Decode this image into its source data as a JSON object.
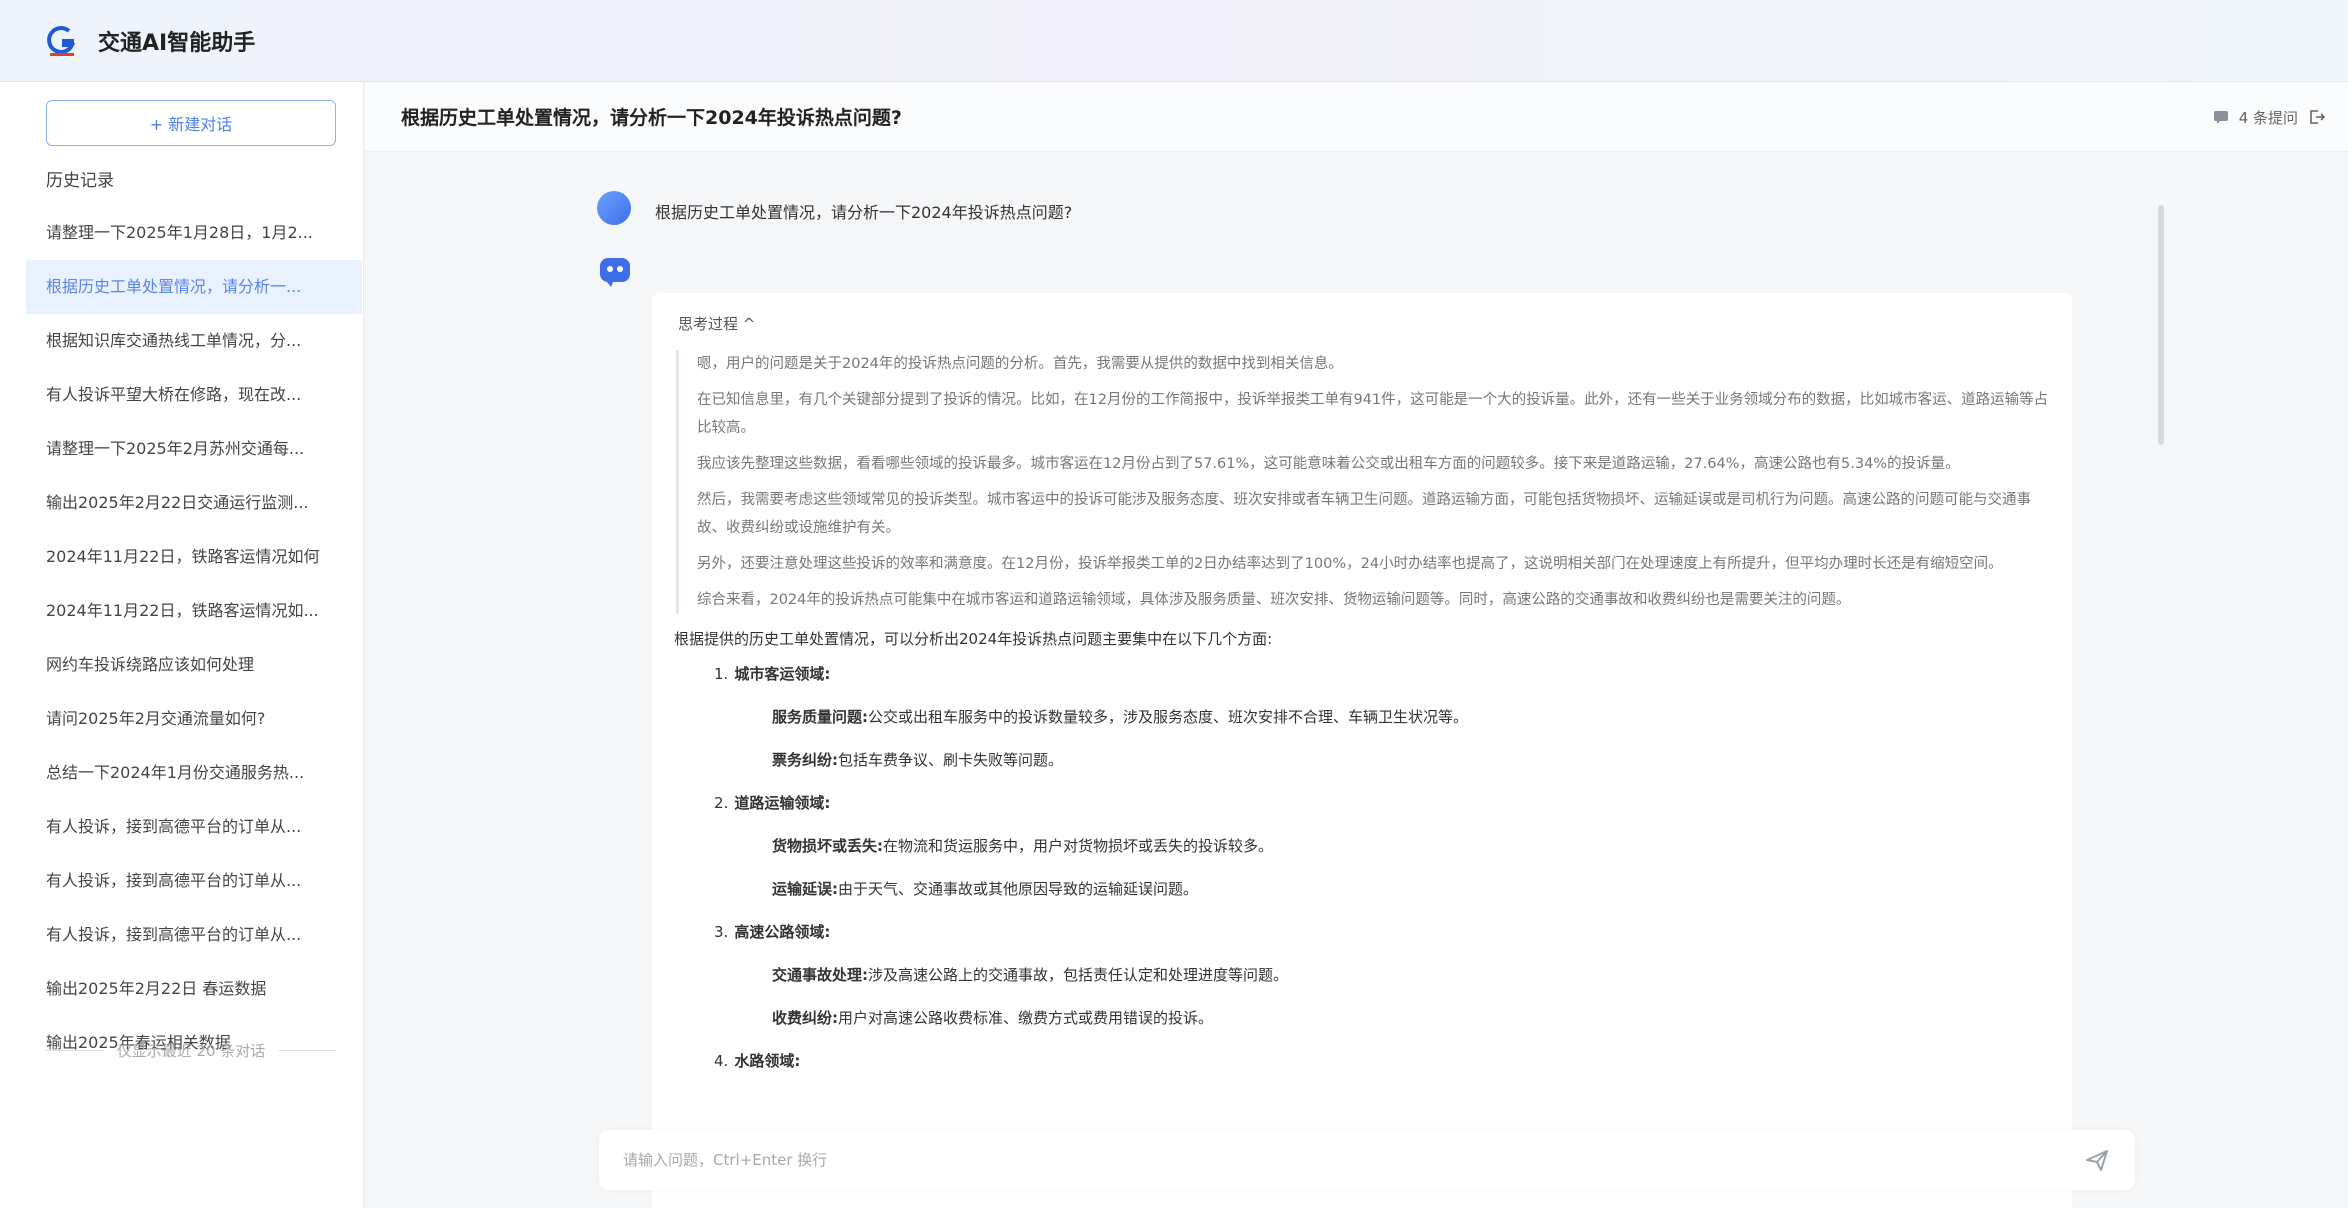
{
  "app": {
    "title": "交通AI智能助手"
  },
  "sidebar": {
    "new_chat_label": "+ 新建对话",
    "history_title": "历史记录",
    "items": [
      {
        "label": "请整理一下2025年1月28日，1月2..."
      },
      {
        "label": "根据历史工单处置情况，请分析一..."
      },
      {
        "label": "根据知识库交通热线工单情况，分..."
      },
      {
        "label": "有人投诉平望大桥在修路，现在改..."
      },
      {
        "label": "请整理一下2025年2月苏州交通每..."
      },
      {
        "label": "输出2025年2月22日交通运行监测..."
      },
      {
        "label": "2024年11月22日，铁路客运情况如何"
      },
      {
        "label": "2024年11月22日，铁路客运情况如..."
      },
      {
        "label": "网约车投诉绕路应该如何处理"
      },
      {
        "label": "请问2025年2月交通流量如何?"
      },
      {
        "label": "总结一下2024年1月份交通服务热..."
      },
      {
        "label": "有人投诉，接到高德平台的订单从..."
      },
      {
        "label": "有人投诉，接到高德平台的订单从..."
      },
      {
        "label": "有人投诉，接到高德平台的订单从..."
      },
      {
        "label": "输出2025年2月22日 春运数据"
      },
      {
        "label": "输出2025年春运相关数据"
      }
    ],
    "footer": "仅显示最近 20 条对话"
  },
  "header": {
    "title": "根据历史工单处置情况，请分析一下2024年投诉热点问题?",
    "question_count": "4 条提问"
  },
  "chat": {
    "user_message": "根据历史工单处置情况，请分析一下2024年投诉热点问题?",
    "think_toggle": "思考过程 ^",
    "think": [
      "嗯，用户的问题是关于2024年的投诉热点问题的分析。首先，我需要从提供的数据中找到相关信息。",
      "在已知信息里，有几个关键部分提到了投诉的情况。比如，在12月份的工作简报中，投诉举报类工单有941件，这可能是一个大的投诉量。此外，还有一些关于业务领域分布的数据，比如城市客运、道路运输等占比较高。",
      "我应该先整理这些数据，看看哪些领域的投诉最多。城市客运在12月份占到了57.61%，这可能意味着公交或出租车方面的问题较多。接下来是道路运输，27.64%，高速公路也有5.34%的投诉量。",
      "然后，我需要考虑这些领域常见的投诉类型。城市客运中的投诉可能涉及服务态度、班次安排或者车辆卫生问题。道路运输方面，可能包括货物损坏、运输延误或是司机行为问题。高速公路的问题可能与交通事故、收费纠纷或设施维护有关。",
      "另外，还要注意处理这些投诉的效率和满意度。在12月份，投诉举报类工单的2日办结率达到了100%，24小时办结率也提高了，这说明相关部门在处理速度上有所提升，但平均办理时长还是有缩短空间。",
      "综合来看，2024年的投诉热点可能集中在城市客运和道路运输领域，具体涉及服务质量、班次安排、货物运输问题等。同时，高速公路的交通事故和收费纠纷也是需要关注的问题。"
    ],
    "answer_intro": "根据提供的历史工单处置情况，可以分析出2024年投诉热点问题主要集中在以下几个方面:",
    "sections": [
      {
        "num": "1.",
        "title": "城市客运领域:",
        "points": [
          {
            "label": "服务质量问题:",
            "text": "公交或出租车服务中的投诉数量较多，涉及服务态度、班次安排不合理、车辆卫生状况等。"
          },
          {
            "label": "票务纠纷:",
            "text": "包括车费争议、刷卡失败等问题。"
          }
        ]
      },
      {
        "num": "2.",
        "title": "道路运输领域:",
        "points": [
          {
            "label": "货物损坏或丢失:",
            "text": "在物流和货运服务中，用户对货物损坏或丢失的投诉较多。"
          },
          {
            "label": "运输延误:",
            "text": "由于天气、交通事故或其他原因导致的运输延误问题。"
          }
        ]
      },
      {
        "num": "3.",
        "title": "高速公路领域:",
        "points": [
          {
            "label": "交通事故处理:",
            "text": "涉及高速公路上的交通事故，包括责任认定和处理进度等问题。"
          },
          {
            "label": "收费纠纷:",
            "text": "用户对高速公路收费标准、缴费方式或费用错误的投诉。"
          }
        ]
      },
      {
        "num": "4.",
        "title": "水路领域:",
        "points": []
      }
    ]
  },
  "input": {
    "placeholder": "请输入问题，Ctrl+Enter 换行"
  },
  "icons": {
    "logo": "logo-icon",
    "question_count": "chat-bubble-icon",
    "share": "share-icon",
    "bot": "bot-icon",
    "send": "send-icon"
  },
  "colors": {
    "accent": "#4d7ff0",
    "active_bg": "#eaf1fe"
  }
}
